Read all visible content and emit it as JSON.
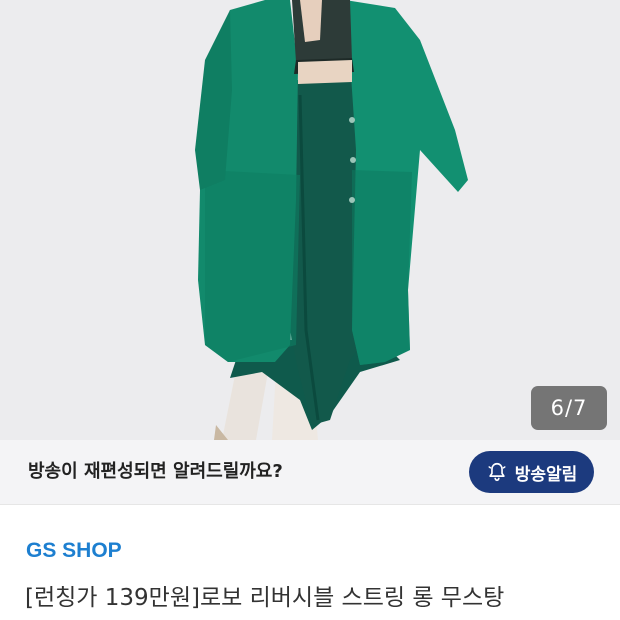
{
  "gallery": {
    "current": 6,
    "total": 7,
    "counter_label": "6/7"
  },
  "notify": {
    "message": "방송이 재편성되면 알려드릴까요?",
    "button_label": "방송알림",
    "button_icon": "bell-icon",
    "button_color": "#1c3a7e"
  },
  "product": {
    "brand": "GS SHOP",
    "brand_color": "#1d7fd0",
    "title": "[런칭가 139만원]로보 리버시블 스트링 롱 무스탕"
  }
}
